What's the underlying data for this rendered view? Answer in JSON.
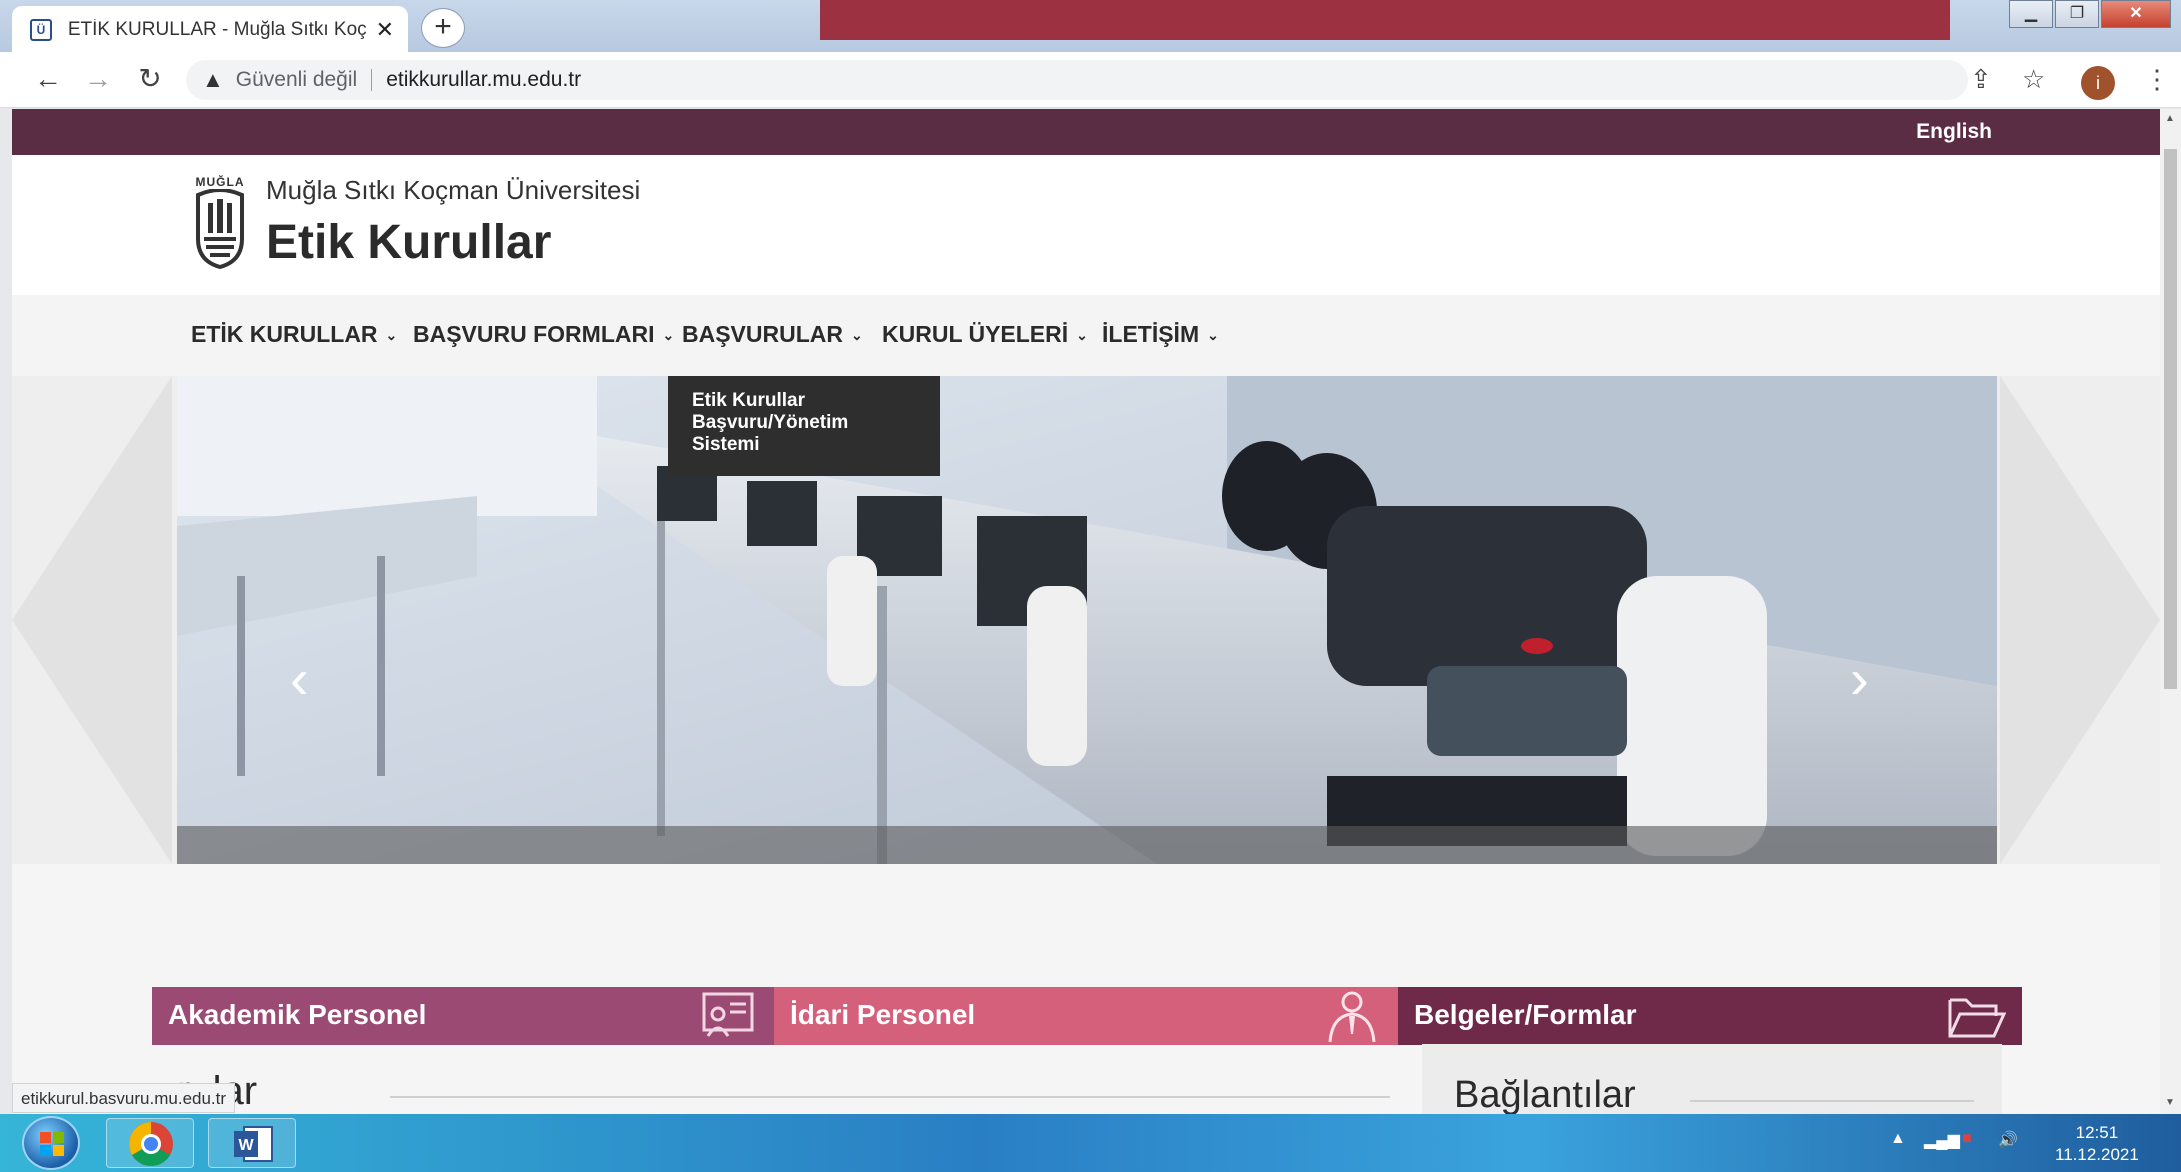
{
  "browser": {
    "tab_title": "ETİK KURULLAR - Muğla Sıtkı Koç",
    "security_label": "Güvenli değil",
    "url": "etikkurullar.mu.edu.tr",
    "profile_initial": "i"
  },
  "page": {
    "lang_link": "English",
    "university_name": "Muğla Sıtkı Koçman Üniversitesi",
    "site_title": "Etik Kurullar",
    "logo_text": "MUĞLA",
    "nav": [
      {
        "label": "ETİK KURULLAR"
      },
      {
        "label": "BAŞVURU FORMLARI"
      },
      {
        "label": "BAŞVURULAR"
      },
      {
        "label": "KURUL ÜYELERİ"
      },
      {
        "label": "İLETİŞİM"
      }
    ],
    "dropdown_item": "Etik Kurullar Başvuru/Yönetim Sistemi",
    "quicklinks": [
      {
        "label": "Akademik Personel",
        "color": "#9b4b73"
      },
      {
        "label": "İdari Personel",
        "color": "#d4607c"
      },
      {
        "label": "Belgeler/Formlar",
        "color": "#6e2a48"
      }
    ],
    "content_title_partial": "rular",
    "sidebar_title": "Bağlantılar",
    "status_link": "etikkurul.basvuru.mu.edu.tr"
  },
  "taskbar": {
    "time": "12:51",
    "date": "11.12.2021"
  },
  "colors": {
    "brand_dark": "#5a2d44",
    "title_band": "#9b3141"
  }
}
